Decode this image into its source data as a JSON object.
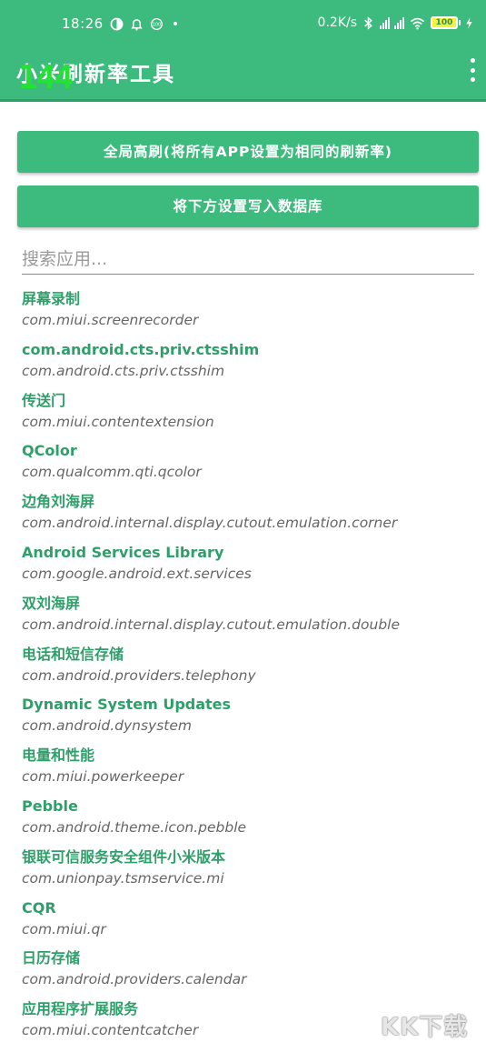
{
  "status_bar": {
    "time": "18:26",
    "network_speed": "0.2K/s",
    "battery_level": "100",
    "icons": [
      "mode-icon",
      "notification-icon",
      "badge-100-icon",
      "bluetooth-icon",
      "signal-hd-1-icon",
      "signal-hd-2-icon",
      "wifi-icon",
      "battery-icon",
      "charging-icon"
    ]
  },
  "app_bar": {
    "title": "小米刷新率工具",
    "fps_overlay": "144",
    "menu_icon": "more-vert-icon"
  },
  "buttons": {
    "global_refresh": "全局高刷(将所有APP设置为相同的刷新率)",
    "write_database": "将下方设置写入数据库"
  },
  "search": {
    "placeholder": "搜索应用..."
  },
  "apps": [
    {
      "name": "屏幕录制",
      "package": "com.miui.screenrecorder"
    },
    {
      "name": "com.android.cts.priv.ctsshim",
      "package": "com.android.cts.priv.ctsshim"
    },
    {
      "name": "传送门",
      "package": "com.miui.contentextension"
    },
    {
      "name": "QColor",
      "package": "com.qualcomm.qti.qcolor"
    },
    {
      "name": "边角刘海屏",
      "package": "com.android.internal.display.cutout.emulation.corner"
    },
    {
      "name": "Android Services Library",
      "package": "com.google.android.ext.services"
    },
    {
      "name": "双刘海屏",
      "package": "com.android.internal.display.cutout.emulation.double"
    },
    {
      "name": "电话和短信存储",
      "package": "com.android.providers.telephony"
    },
    {
      "name": "Dynamic System Updates",
      "package": "com.android.dynsystem"
    },
    {
      "name": "电量和性能",
      "package": "com.miui.powerkeeper"
    },
    {
      "name": "Pebble",
      "package": "com.android.theme.icon.pebble"
    },
    {
      "name": "银联可信服务安全组件小米版本",
      "package": "com.unionpay.tsmservice.mi"
    },
    {
      "name": "CQR",
      "package": "com.miui.qr"
    },
    {
      "name": "日历存储",
      "package": "com.android.providers.calendar"
    },
    {
      "name": "应用程序扩展服务",
      "package": "com.miui.contentcatcher"
    }
  ],
  "watermark": "KK下载",
  "colors": {
    "primary": "#3dbb7e",
    "primary_dark": "#2f9f6a",
    "fps_overlay": "#23e234",
    "package_text": "#666666"
  }
}
